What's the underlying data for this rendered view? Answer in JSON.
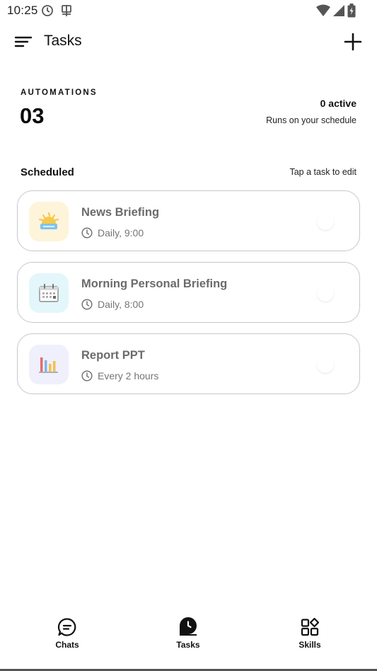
{
  "status_bar": {
    "time": "10:25"
  },
  "header": {
    "title": "Tasks"
  },
  "automations": {
    "label": "AUTOMATIONS",
    "count": "03",
    "active": "0 active",
    "subtitle": "Runs on your schedule"
  },
  "scheduled": {
    "label": "Scheduled",
    "hint": "Tap a task to edit",
    "tasks": [
      {
        "title": "News Briefing",
        "schedule": "Daily, 9:00",
        "icon": "sunrise-icon",
        "icon_bg": "#fdf4da",
        "enabled": false
      },
      {
        "title": "Morning Personal Briefing",
        "schedule": "Daily, 8:00",
        "icon": "calendar-icon",
        "icon_bg": "#e3f7fa",
        "enabled": false
      },
      {
        "title": "Report PPT",
        "schedule": "Every 2 hours",
        "icon": "bar-chart-icon",
        "icon_bg": "#f0effc",
        "enabled": false
      }
    ]
  },
  "nav": {
    "items": [
      {
        "label": "Chats",
        "icon": "chat-bubble-icon"
      },
      {
        "label": "Tasks",
        "icon": "clock-tasks-icon",
        "active": true
      },
      {
        "label": "Skills",
        "icon": "grid-shapes-icon"
      }
    ]
  }
}
